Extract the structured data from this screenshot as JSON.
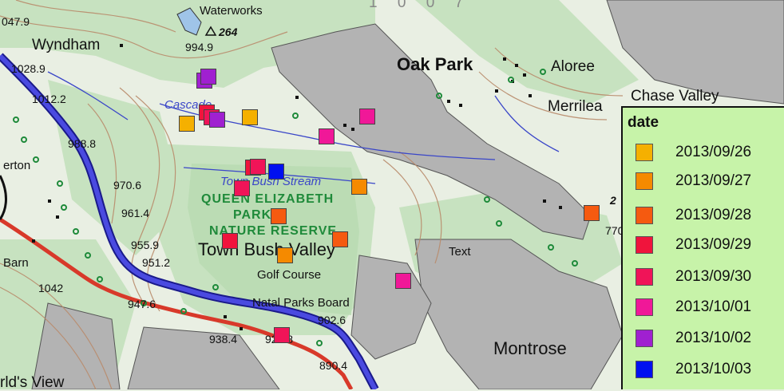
{
  "map": {
    "places": {
      "oak_park": "Oak Park",
      "aloree": "Aloree",
      "merrilea": "Merrilea",
      "chase_valley": "Chase Valley",
      "wyndham": "Wyndham",
      "waterworks": "Waterworks",
      "town_bush_valley": "Town Bush Valley",
      "golf_course": "Golf Course",
      "natal_parks_board": "Natal Parks Board",
      "montrose": "Montrose",
      "barn": "Barn",
      "erton": "erton",
      "worlds_view": "rld's View",
      "text": "Text",
      "cascade": "Cascade"
    },
    "water": {
      "stream": "Town Bush Stream"
    },
    "reserve": {
      "line1": "QUEEN ELIZABETH",
      "line2": "PARK",
      "line3": "NATURE RESERVE"
    },
    "elevations": {
      "e0479": "047.9",
      "e10289": "1028.9",
      "e10122": "1012.2",
      "e9888": "988.8",
      "e9706": "970.6",
      "e9614": "961.4",
      "e9559": "955.9",
      "e9512": "951.2",
      "e1042": "1042",
      "e9476": "947.6",
      "e9384": "938.4",
      "e9238": "923.8",
      "e9026": "902.6",
      "e8904": "890.4",
      "e9949": "994.9",
      "e264": "264",
      "e770": "770",
      "e2": "2"
    },
    "top_fragment": "1 0 0 7",
    "colors": {
      "background": "#e8efe2",
      "forest": "#c9e3c3",
      "urban": "#b4b4b4",
      "highway": "#3b3bd6",
      "main_road": "#d83a2a",
      "contour": "#b88a6a",
      "stream": "#3a46c8"
    }
  },
  "legend": {
    "title": "date",
    "entries": [
      {
        "label": "2013/09/26",
        "color": "#f5b000"
      },
      {
        "label": "2013/09/27",
        "color": "#f58a00"
      },
      {
        "label": "2013/09/28",
        "color": "#f55a10"
      },
      {
        "label": "2013/09/29",
        "color": "#f0143c"
      },
      {
        "label": "2013/09/30",
        "color": "#f01458"
      },
      {
        "label": "2013/10/01",
        "color": "#f01898"
      },
      {
        "label": "2013/10/02",
        "color": "#a020d0"
      },
      {
        "label": "2013/10/03",
        "color": "#0010f0"
      }
    ]
  },
  "markers": [
    {
      "date_index": 6
    },
    {
      "date_index": 6
    },
    {
      "date_index": 0
    },
    {
      "date_index": 0
    },
    {
      "date_index": 3
    },
    {
      "date_index": 4
    },
    {
      "date_index": 6
    },
    {
      "date_index": 5
    },
    {
      "date_index": 5
    },
    {
      "date_index": 3
    },
    {
      "date_index": 4
    },
    {
      "date_index": 7
    },
    {
      "date_index": 4
    },
    {
      "date_index": 1
    },
    {
      "date_index": 2
    },
    {
      "date_index": 3
    },
    {
      "date_index": 2
    },
    {
      "date_index": 1
    },
    {
      "date_index": 5
    },
    {
      "date_index": 4
    },
    {
      "date_index": 2
    }
  ]
}
